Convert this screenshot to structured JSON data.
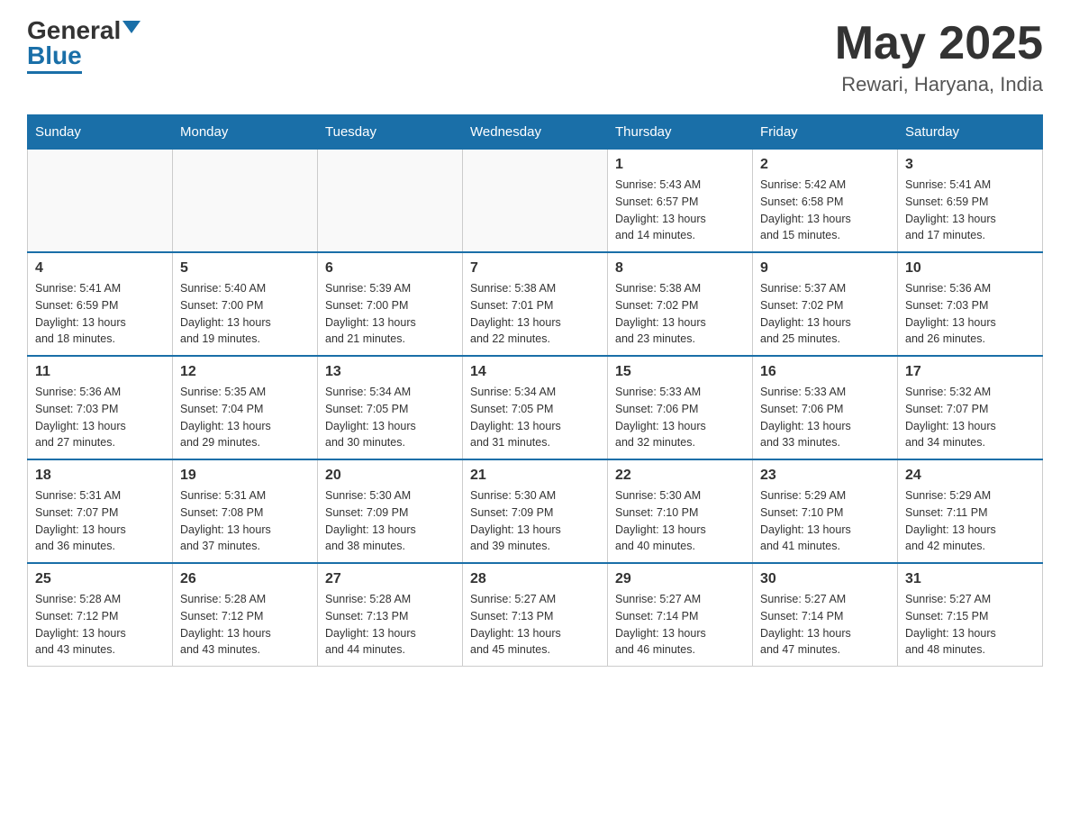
{
  "header": {
    "logo_general": "General",
    "logo_blue": "Blue",
    "month_title": "May 2025",
    "location": "Rewari, Haryana, India"
  },
  "days_of_week": [
    "Sunday",
    "Monday",
    "Tuesday",
    "Wednesday",
    "Thursday",
    "Friday",
    "Saturday"
  ],
  "weeks": [
    [
      {
        "day": "",
        "info": ""
      },
      {
        "day": "",
        "info": ""
      },
      {
        "day": "",
        "info": ""
      },
      {
        "day": "",
        "info": ""
      },
      {
        "day": "1",
        "info": "Sunrise: 5:43 AM\nSunset: 6:57 PM\nDaylight: 13 hours\nand 14 minutes."
      },
      {
        "day": "2",
        "info": "Sunrise: 5:42 AM\nSunset: 6:58 PM\nDaylight: 13 hours\nand 15 minutes."
      },
      {
        "day": "3",
        "info": "Sunrise: 5:41 AM\nSunset: 6:59 PM\nDaylight: 13 hours\nand 17 minutes."
      }
    ],
    [
      {
        "day": "4",
        "info": "Sunrise: 5:41 AM\nSunset: 6:59 PM\nDaylight: 13 hours\nand 18 minutes."
      },
      {
        "day": "5",
        "info": "Sunrise: 5:40 AM\nSunset: 7:00 PM\nDaylight: 13 hours\nand 19 minutes."
      },
      {
        "day": "6",
        "info": "Sunrise: 5:39 AM\nSunset: 7:00 PM\nDaylight: 13 hours\nand 21 minutes."
      },
      {
        "day": "7",
        "info": "Sunrise: 5:38 AM\nSunset: 7:01 PM\nDaylight: 13 hours\nand 22 minutes."
      },
      {
        "day": "8",
        "info": "Sunrise: 5:38 AM\nSunset: 7:02 PM\nDaylight: 13 hours\nand 23 minutes."
      },
      {
        "day": "9",
        "info": "Sunrise: 5:37 AM\nSunset: 7:02 PM\nDaylight: 13 hours\nand 25 minutes."
      },
      {
        "day": "10",
        "info": "Sunrise: 5:36 AM\nSunset: 7:03 PM\nDaylight: 13 hours\nand 26 minutes."
      }
    ],
    [
      {
        "day": "11",
        "info": "Sunrise: 5:36 AM\nSunset: 7:03 PM\nDaylight: 13 hours\nand 27 minutes."
      },
      {
        "day": "12",
        "info": "Sunrise: 5:35 AM\nSunset: 7:04 PM\nDaylight: 13 hours\nand 29 minutes."
      },
      {
        "day": "13",
        "info": "Sunrise: 5:34 AM\nSunset: 7:05 PM\nDaylight: 13 hours\nand 30 minutes."
      },
      {
        "day": "14",
        "info": "Sunrise: 5:34 AM\nSunset: 7:05 PM\nDaylight: 13 hours\nand 31 minutes."
      },
      {
        "day": "15",
        "info": "Sunrise: 5:33 AM\nSunset: 7:06 PM\nDaylight: 13 hours\nand 32 minutes."
      },
      {
        "day": "16",
        "info": "Sunrise: 5:33 AM\nSunset: 7:06 PM\nDaylight: 13 hours\nand 33 minutes."
      },
      {
        "day": "17",
        "info": "Sunrise: 5:32 AM\nSunset: 7:07 PM\nDaylight: 13 hours\nand 34 minutes."
      }
    ],
    [
      {
        "day": "18",
        "info": "Sunrise: 5:31 AM\nSunset: 7:07 PM\nDaylight: 13 hours\nand 36 minutes."
      },
      {
        "day": "19",
        "info": "Sunrise: 5:31 AM\nSunset: 7:08 PM\nDaylight: 13 hours\nand 37 minutes."
      },
      {
        "day": "20",
        "info": "Sunrise: 5:30 AM\nSunset: 7:09 PM\nDaylight: 13 hours\nand 38 minutes."
      },
      {
        "day": "21",
        "info": "Sunrise: 5:30 AM\nSunset: 7:09 PM\nDaylight: 13 hours\nand 39 minutes."
      },
      {
        "day": "22",
        "info": "Sunrise: 5:30 AM\nSunset: 7:10 PM\nDaylight: 13 hours\nand 40 minutes."
      },
      {
        "day": "23",
        "info": "Sunrise: 5:29 AM\nSunset: 7:10 PM\nDaylight: 13 hours\nand 41 minutes."
      },
      {
        "day": "24",
        "info": "Sunrise: 5:29 AM\nSunset: 7:11 PM\nDaylight: 13 hours\nand 42 minutes."
      }
    ],
    [
      {
        "day": "25",
        "info": "Sunrise: 5:28 AM\nSunset: 7:12 PM\nDaylight: 13 hours\nand 43 minutes."
      },
      {
        "day": "26",
        "info": "Sunrise: 5:28 AM\nSunset: 7:12 PM\nDaylight: 13 hours\nand 43 minutes."
      },
      {
        "day": "27",
        "info": "Sunrise: 5:28 AM\nSunset: 7:13 PM\nDaylight: 13 hours\nand 44 minutes."
      },
      {
        "day": "28",
        "info": "Sunrise: 5:27 AM\nSunset: 7:13 PM\nDaylight: 13 hours\nand 45 minutes."
      },
      {
        "day": "29",
        "info": "Sunrise: 5:27 AM\nSunset: 7:14 PM\nDaylight: 13 hours\nand 46 minutes."
      },
      {
        "day": "30",
        "info": "Sunrise: 5:27 AM\nSunset: 7:14 PM\nDaylight: 13 hours\nand 47 minutes."
      },
      {
        "day": "31",
        "info": "Sunrise: 5:27 AM\nSunset: 7:15 PM\nDaylight: 13 hours\nand 48 minutes."
      }
    ]
  ]
}
